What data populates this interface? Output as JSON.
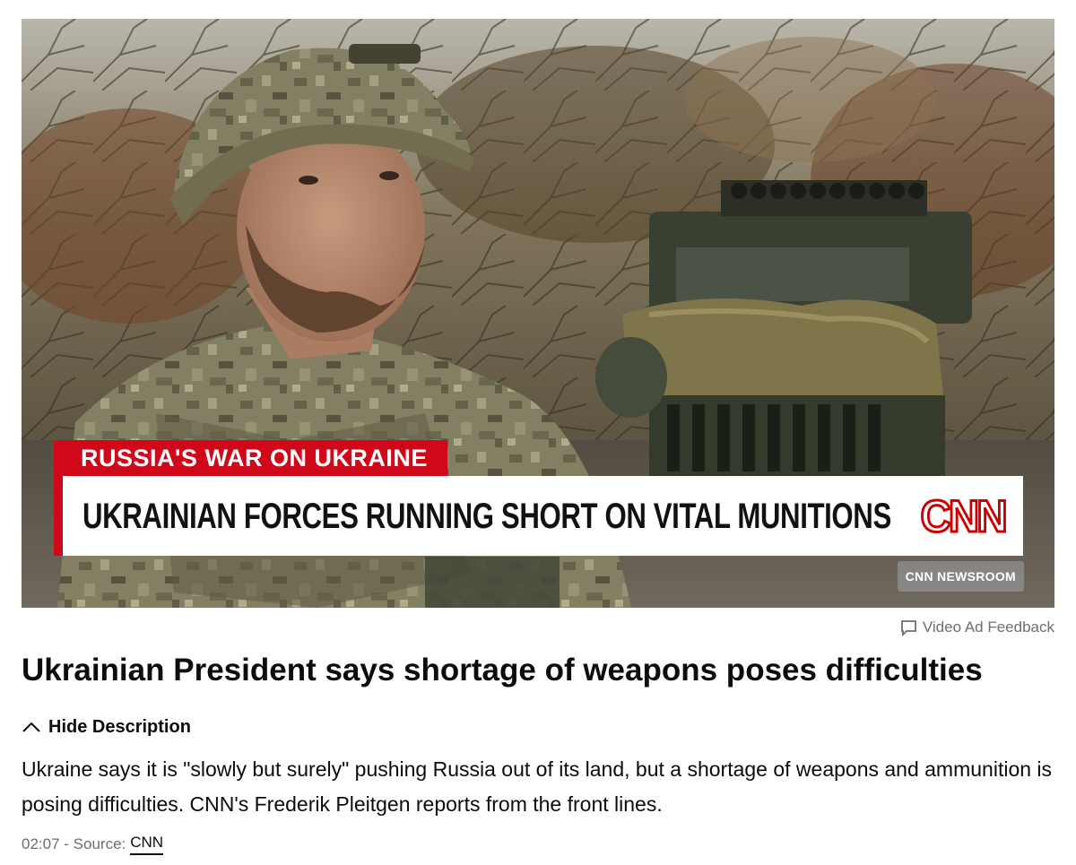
{
  "video": {
    "chyron_kicker": "RUSSIA'S WAR ON UKRAINE",
    "chyron_headline": "UKRAINIAN FORCES RUNNING SHORT ON VITAL MUNITIONS",
    "logo_text": "CNN",
    "show_bug": "CNN NEWSROOM",
    "colors": {
      "chyron_red": "#d0091a",
      "logo_red": "#cc0000"
    }
  },
  "ad_feedback": {
    "icon": "speech-bubble-icon",
    "label": "Video Ad Feedback"
  },
  "article": {
    "headline": "Ukrainian President says shortage of weapons poses difficulties",
    "toggle_icon": "chevron-up-icon",
    "toggle_label": "Hide Description",
    "description": "Ukraine says it is \"slowly but surely\" pushing Russia out of its land, but a shortage of weapons and ammunition is posing difficulties. CNN's Frederik Pleitgen reports from the front lines.",
    "duration": "02:07",
    "source_prefix": " - Source:",
    "source_name": "CNN"
  }
}
